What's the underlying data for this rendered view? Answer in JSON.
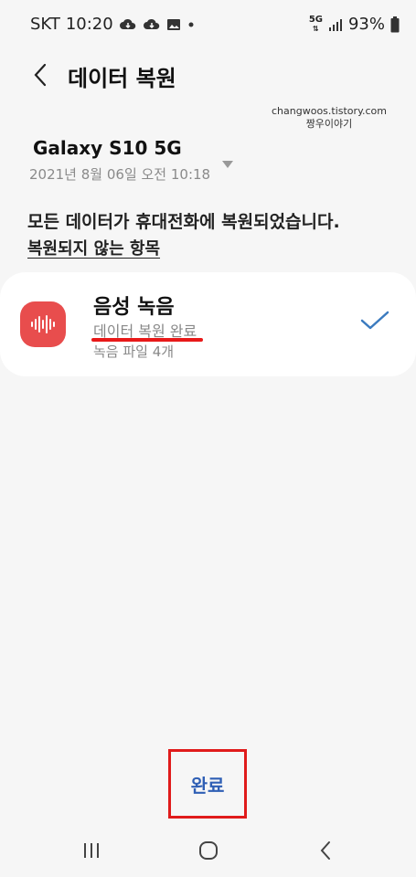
{
  "status_bar": {
    "carrier": "SKT",
    "time": "10:20",
    "network": "5G",
    "battery": "93%",
    "icons": [
      "cloud-sync-icon",
      "cloud-sync-icon",
      "image-icon",
      "dot-icon",
      "network-5g-icon",
      "signal-icon",
      "battery-icon"
    ]
  },
  "header": {
    "title": "데이터 복원",
    "back_icon": "back-arrow-icon"
  },
  "watermark": {
    "line1": "changwoos.tistory.com",
    "line2": "짱우이야기"
  },
  "device": {
    "name": "Galaxy S10 5G",
    "date": "2021년 8월 06일 오전 10:18",
    "dropdown_icon": "caret-down-icon"
  },
  "info": {
    "message": "모든 데이터가 휴대전화에 복원되었습니다.",
    "link": "복원되지 않는 항목"
  },
  "items": [
    {
      "name": "음성 녹음",
      "status": "데이터 복원 완료",
      "detail": "녹음 파일 4개",
      "icon": "voice-recorder-icon",
      "check_icon": "checkmark-icon"
    }
  ],
  "footer": {
    "done_label": "완료"
  },
  "nav": {
    "recents_icon": "recents-icon",
    "home_icon": "home-icon",
    "back_icon": "back-icon"
  },
  "colors": {
    "background": "#f6f6f6",
    "card": "#ffffff",
    "accent_blue": "#2f5fb5",
    "highlight_red": "#e01b1b",
    "recorder_icon": "#e84d4d",
    "check": "#3b7bbf"
  }
}
